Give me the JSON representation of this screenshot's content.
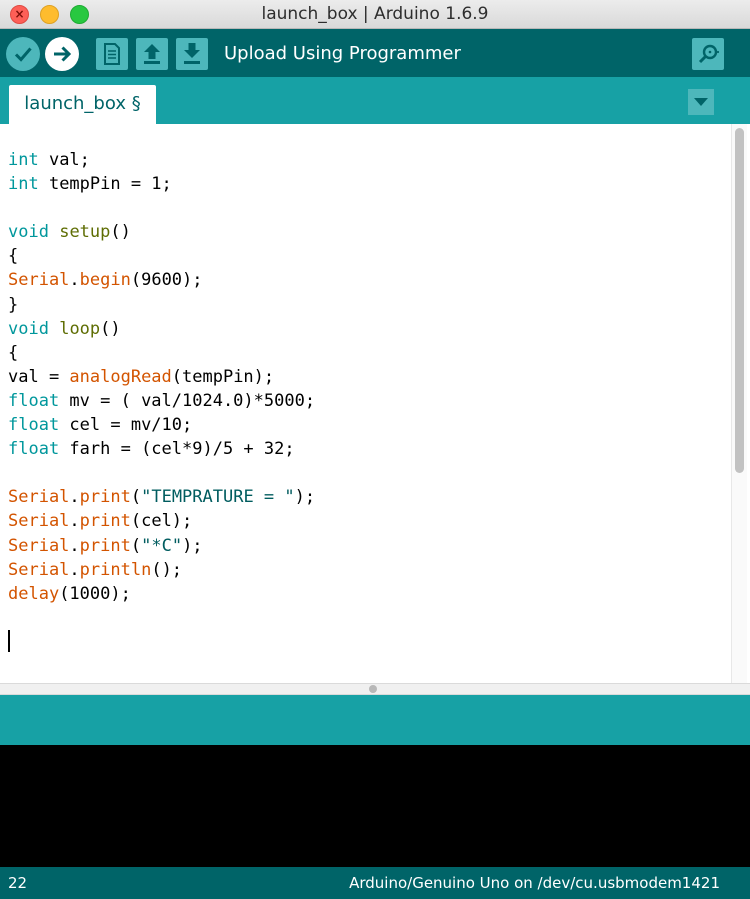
{
  "window": {
    "title": "launch_box | Arduino 1.6.9",
    "close_glyph": "×"
  },
  "toolbar": {
    "buttons": [
      {
        "name": "verify",
        "icon": "check-icon"
      },
      {
        "name": "upload",
        "icon": "arrow-right-icon"
      },
      {
        "name": "new",
        "icon": "document-icon"
      },
      {
        "name": "open",
        "icon": "arrow-up-icon"
      },
      {
        "name": "save",
        "icon": "arrow-down-icon"
      }
    ],
    "hint": "Upload Using Programmer",
    "serial_monitor_icon": "magnifier-icon"
  },
  "tabs": [
    {
      "label": "launch_box §",
      "active": true
    }
  ],
  "tab_menu_icon": "triangle-down-icon",
  "editor": {
    "lines": [
      [
        {
          "t": "int",
          "c": "kw"
        },
        {
          "t": " val;"
        }
      ],
      [
        {
          "t": "int",
          "c": "kw"
        },
        {
          "t": " tempPin = 1;"
        }
      ],
      [],
      [
        {
          "t": "void",
          "c": "kw"
        },
        {
          "t": " "
        },
        {
          "t": "setup",
          "c": "fs"
        },
        {
          "t": "()"
        }
      ],
      [
        {
          "t": "{"
        }
      ],
      [
        {
          "t": "Serial",
          "c": "fn"
        },
        {
          "t": "."
        },
        {
          "t": "begin",
          "c": "fn"
        },
        {
          "t": "(9600);"
        }
      ],
      [
        {
          "t": "}"
        }
      ],
      [
        {
          "t": "void",
          "c": "kw"
        },
        {
          "t": " "
        },
        {
          "t": "loop",
          "c": "fs"
        },
        {
          "t": "()"
        }
      ],
      [
        {
          "t": "{"
        }
      ],
      [
        {
          "t": "val = "
        },
        {
          "t": "analogRead",
          "c": "fn"
        },
        {
          "t": "(tempPin);"
        }
      ],
      [
        {
          "t": "float",
          "c": "kw"
        },
        {
          "t": " mv = ( val/1024.0)*5000;"
        }
      ],
      [
        {
          "t": "float",
          "c": "kw"
        },
        {
          "t": " cel = mv/10;"
        }
      ],
      [
        {
          "t": "float",
          "c": "kw"
        },
        {
          "t": " farh = (cel*9)/5 + 32;"
        }
      ],
      [],
      [
        {
          "t": "Serial",
          "c": "fn"
        },
        {
          "t": "."
        },
        {
          "t": "print",
          "c": "fn"
        },
        {
          "t": "("
        },
        {
          "t": "\"TEMPRATURE = \"",
          "c": "st"
        },
        {
          "t": ");"
        }
      ],
      [
        {
          "t": "Serial",
          "c": "fn"
        },
        {
          "t": "."
        },
        {
          "t": "print",
          "c": "fn"
        },
        {
          "t": "(cel);"
        }
      ],
      [
        {
          "t": "Serial",
          "c": "fn"
        },
        {
          "t": "."
        },
        {
          "t": "print",
          "c": "fn"
        },
        {
          "t": "("
        },
        {
          "t": "\"*C\"",
          "c": "st"
        },
        {
          "t": ");"
        }
      ],
      [
        {
          "t": "Serial",
          "c": "fn"
        },
        {
          "t": "."
        },
        {
          "t": "println",
          "c": "fn"
        },
        {
          "t": "();"
        }
      ],
      [
        {
          "t": "delay",
          "c": "fn"
        },
        {
          "t": "(1000);"
        }
      ]
    ]
  },
  "status": {
    "line": "22",
    "board": "Arduino/Genuino Uno on /dev/cu.usbmodem1421"
  },
  "colors": {
    "toolbar": "#006468",
    "tabstrip": "#17a1a5",
    "button": "#4db7bb",
    "keyword": "#00979c",
    "function": "#d35400",
    "console": "#000000"
  }
}
